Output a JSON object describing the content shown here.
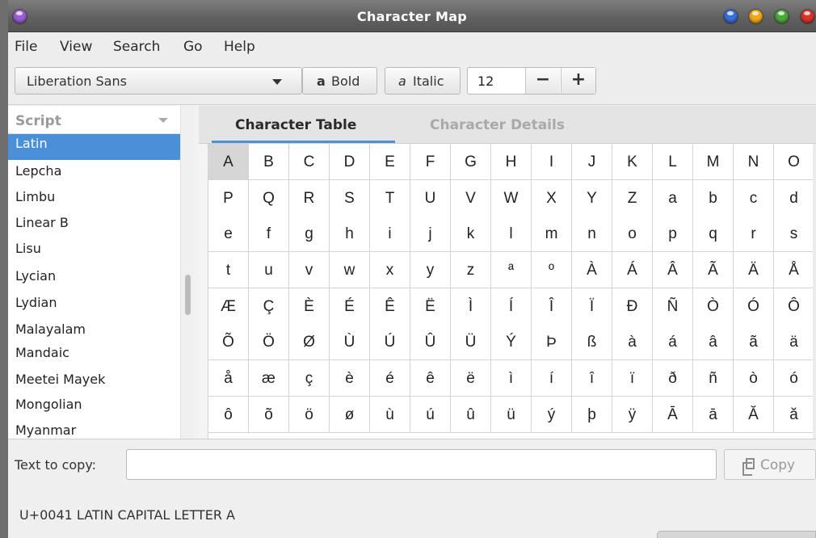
{
  "window": {
    "title": "Character Map",
    "left_orb_color": "#9a5fd4",
    "buttons": [
      {
        "name": "blue",
        "color": "#3a6fd8"
      },
      {
        "name": "yellow",
        "color": "#f0a81c"
      },
      {
        "name": "green",
        "color": "#4caa3c"
      },
      {
        "name": "red",
        "color": "#d8342c"
      }
    ]
  },
  "menubar": [
    "File",
    "View",
    "Search",
    "Go",
    "Help"
  ],
  "toolbar": {
    "font": "Liberation Sans",
    "bold_icon": "a",
    "bold_label": "Bold",
    "italic_icon": "a",
    "italic_label": "Italic",
    "size": "12",
    "decrement": "−",
    "increment": "+"
  },
  "sidebar": {
    "header": "Script",
    "items": [
      "Latin",
      "Lepcha",
      "Limbu",
      "Linear B",
      "Lisu",
      "Lycian",
      "Lydian",
      "Malayalam",
      "Mandaic",
      "Meetei Mayek",
      "Mongolian",
      "Myanmar"
    ],
    "selected": "Latin"
  },
  "tabs": [
    "Character Table",
    "Character Details"
  ],
  "active_tab": "Character Table",
  "grid": {
    "selected": "A",
    "rows": [
      [
        "A",
        "B",
        "C",
        "D",
        "E",
        "F",
        "G",
        "H",
        "I",
        "J",
        "K",
        "L",
        "M",
        "N",
        "O"
      ],
      [
        "P",
        "Q",
        "R",
        "S",
        "T",
        "U",
        "V",
        "W",
        "X",
        "Y",
        "Z",
        "a",
        "b",
        "c",
        "d"
      ],
      [
        "e",
        "f",
        "g",
        "h",
        "i",
        "j",
        "k",
        "l",
        "m",
        "n",
        "o",
        "p",
        "q",
        "r",
        "s"
      ],
      [
        "t",
        "u",
        "v",
        "w",
        "x",
        "y",
        "z",
        "ª",
        "º",
        "À",
        "Á",
        "Â",
        "Ã",
        "Ä",
        "Å"
      ],
      [
        "Æ",
        "Ç",
        "È",
        "É",
        "Ê",
        "Ë",
        "Ì",
        "Í",
        "Î",
        "Ï",
        "Ð",
        "Ñ",
        "Ò",
        "Ó",
        "Ô"
      ],
      [
        "Õ",
        "Ö",
        "Ø",
        "Ù",
        "Ú",
        "Û",
        "Ü",
        "Ý",
        "Þ",
        "ß",
        "à",
        "á",
        "â",
        "ã",
        "ä"
      ],
      [
        "å",
        "æ",
        "ç",
        "è",
        "é",
        "ê",
        "ë",
        "ì",
        "í",
        "î",
        "ï",
        "ð",
        "ñ",
        "ò",
        "ó"
      ],
      [
        "ô",
        "õ",
        "ö",
        "ø",
        "ù",
        "ú",
        "û",
        "ü",
        "ý",
        "þ",
        "ÿ",
        "Ā",
        "ā",
        "Ă",
        "ă"
      ]
    ]
  },
  "copy": {
    "label": "Text to copy:",
    "value": "",
    "button": "Copy"
  },
  "status": "U+0041 LATIN CAPITAL LETTER A"
}
